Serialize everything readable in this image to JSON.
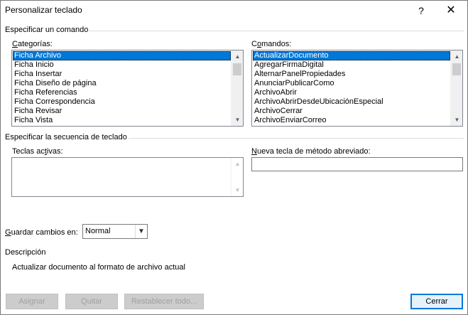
{
  "window": {
    "title": "Personalizar teclado",
    "help_glyph": "?",
    "close_glyph": "✕"
  },
  "command_group": {
    "heading": "Especificar un comando",
    "categories": {
      "label_pre": "",
      "label_accel": "C",
      "label_post": "ategorías:",
      "items": [
        "Ficha Archivo",
        "Ficha Inicio",
        "Ficha Insertar",
        "Ficha Diseño de página",
        "Ficha Referencias",
        "Ficha Correspondencia",
        "Ficha Revisar",
        "Ficha Vista"
      ],
      "selected_index": 0
    },
    "commands": {
      "label_pre": "C",
      "label_accel": "o",
      "label_post": "mandos:",
      "items": [
        "ActualizarDocumento",
        "AgregarFirmaDigital",
        "AlternarPanelPropiedades",
        "AnunciarPublicarComo",
        "ArchivoAbrir",
        "ArchivoAbrirDesdeUbicaciónEspecial",
        "ArchivoCerrar",
        "ArchivoEnviarCorreo"
      ],
      "selected_index": 0
    }
  },
  "sequence_group": {
    "heading": "Especificar la secuencia de teclado",
    "active_keys": {
      "label_pre": "Teclas ac",
      "label_accel": "t",
      "label_post": "ivas:",
      "items": []
    },
    "new_shortcut": {
      "label_pre": "",
      "label_accel": "N",
      "label_post": "ueva tecla de método abreviado:",
      "value": ""
    }
  },
  "save_in": {
    "label_pre": "",
    "label_accel": "G",
    "label_post": "uardar cambios en:",
    "value": "Normal"
  },
  "description": {
    "heading": "Descripción",
    "text": "Actualizar documento al formato de archivo actual"
  },
  "buttons": {
    "assign": "Asignar",
    "remove": "Quitar",
    "reset_all": "Restablecer todo...",
    "close": "Cerrar"
  },
  "icons": {
    "scroll_up": "▲",
    "scroll_down": "▼",
    "dropdown": "▼"
  }
}
